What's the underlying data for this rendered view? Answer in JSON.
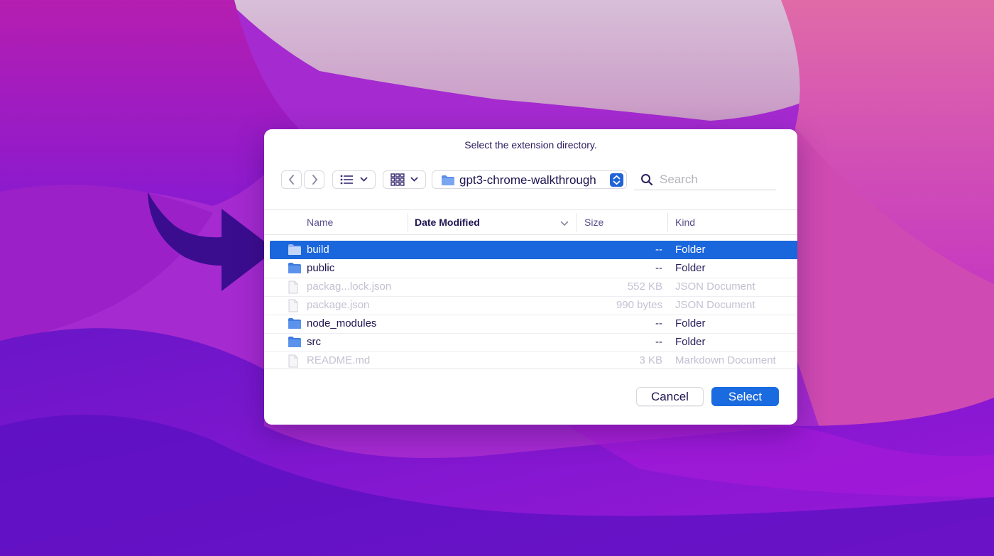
{
  "dialog": {
    "title": "Select the extension directory.",
    "path_label": "gpt3-chrome-walkthrough",
    "search_placeholder": "Search",
    "cancel_label": "Cancel",
    "select_label": "Select"
  },
  "toolbar": {
    "back_icon": "chevron-left-icon",
    "forward_icon": "chevron-right-icon",
    "view_mode_icon": "list-view-icon",
    "group_icon": "grid-view-icon"
  },
  "columns": {
    "name": "Name",
    "date_modified": "Date Modified",
    "size": "Size",
    "kind": "Kind"
  },
  "files": [
    {
      "name": "build",
      "size": "--",
      "kind": "Folder",
      "type": "folder",
      "state": "selected"
    },
    {
      "name": "public",
      "size": "--",
      "kind": "Folder",
      "type": "folder",
      "state": "normal"
    },
    {
      "name": "packag...lock.json",
      "size": "552 KB",
      "kind": "JSON Document",
      "type": "file",
      "state": "disabled"
    },
    {
      "name": "package.json",
      "size": "990 bytes",
      "kind": "JSON Document",
      "type": "file",
      "state": "disabled"
    },
    {
      "name": "node_modules",
      "size": "--",
      "kind": "Folder",
      "type": "folder",
      "state": "normal"
    },
    {
      "name": "src",
      "size": "--",
      "kind": "Folder",
      "type": "folder",
      "state": "normal"
    },
    {
      "name": "README.md",
      "size": "3 KB",
      "kind": "Markdown Document",
      "type": "file",
      "state": "disabled"
    }
  ],
  "colors": {
    "selection": "#1a66dc",
    "accent": "#1a6ae0",
    "arrow": "#3a0d8f"
  }
}
